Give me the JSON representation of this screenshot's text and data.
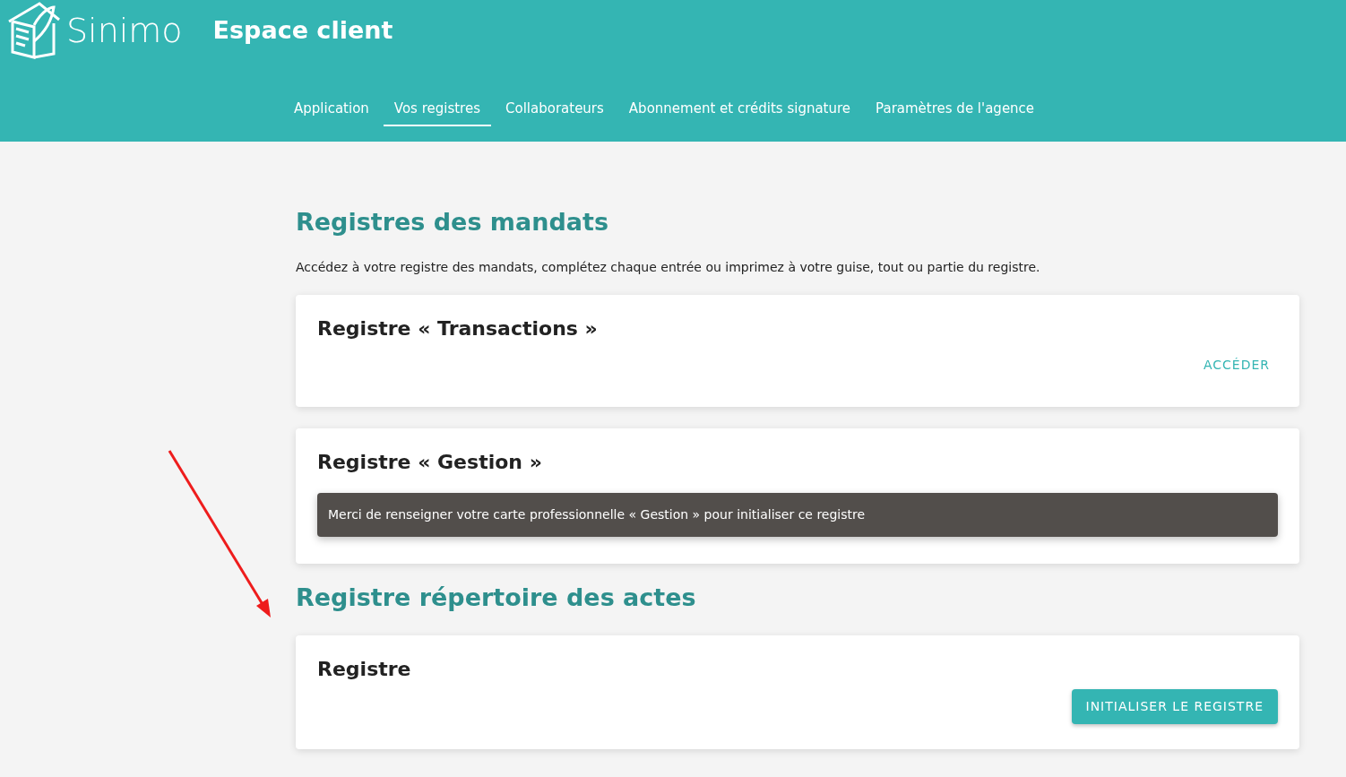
{
  "header": {
    "brand": "Sinimo",
    "title": "Espace client"
  },
  "nav": [
    {
      "label": "Application",
      "selected": false
    },
    {
      "label": "Vos registres",
      "selected": true
    },
    {
      "label": "Collaborateurs",
      "selected": false
    },
    {
      "label": "Abonnement et crédits signature",
      "selected": false
    },
    {
      "label": "Paramètres de l'agence",
      "selected": false
    }
  ],
  "sections": [
    {
      "title": "Registres des mandats",
      "intro": "Accédez à votre registre des mandats, complétez chaque entrée ou imprimez à votre guise, tout ou partie du registre.",
      "cards": [
        {
          "title": "Registre « Transactions »",
          "kind": "text_button",
          "action": "ACCÉDER"
        },
        {
          "title": "Registre « Gestion »",
          "kind": "notice",
          "notice": "Merci de renseigner votre carte professionnelle « Gestion » pour initialiser ce registre"
        }
      ]
    },
    {
      "title": "Registre répertoire des actes",
      "cards": [
        {
          "title": "Registre",
          "kind": "filled_button",
          "action": "INITIALISER LE REGISTRE"
        }
      ]
    }
  ]
}
